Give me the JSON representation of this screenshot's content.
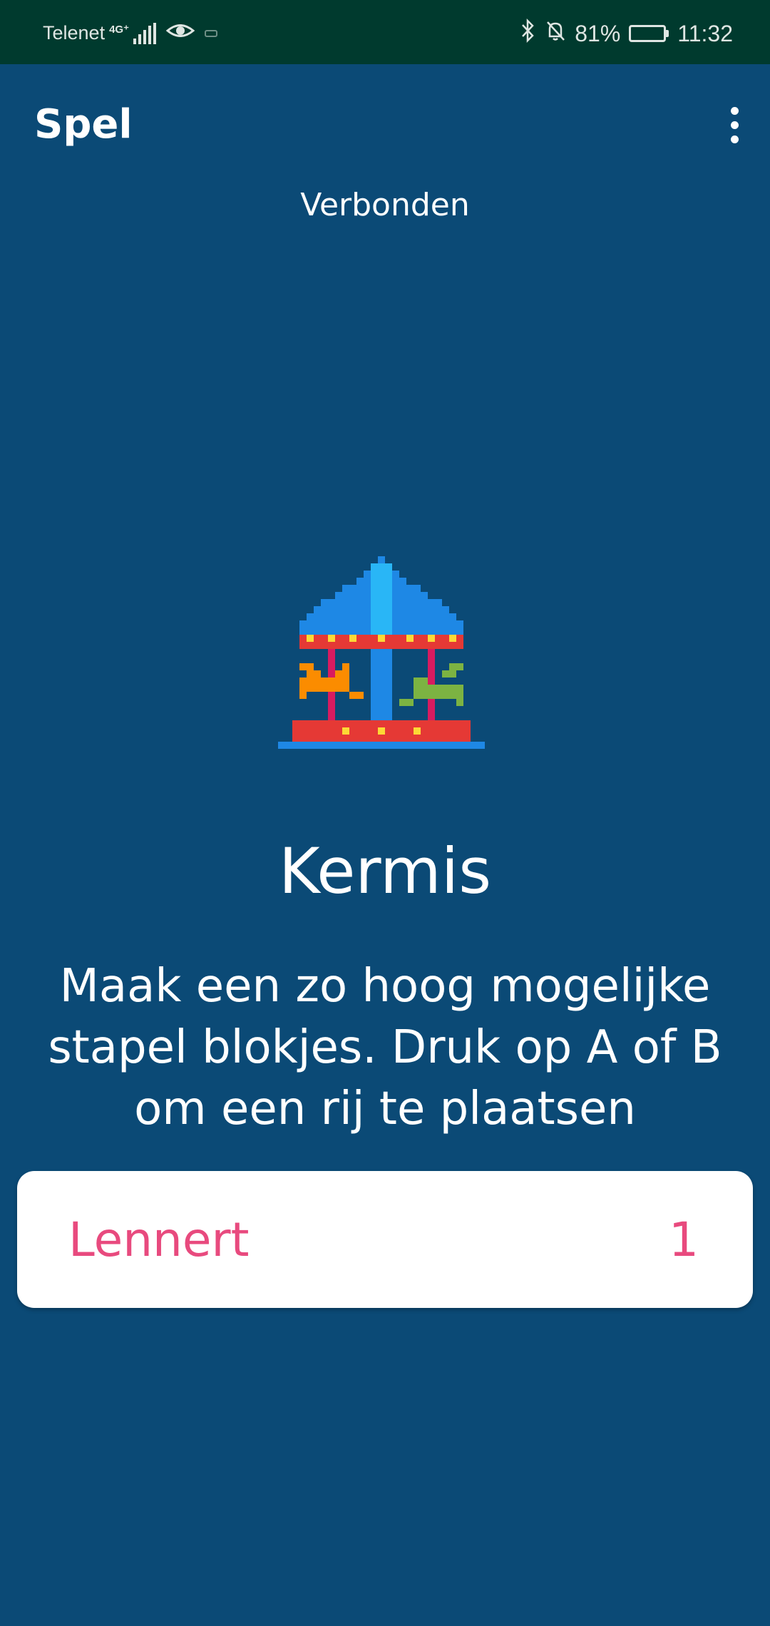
{
  "statusbar": {
    "carrier": "Telenet",
    "network_type": "4G⁺",
    "battery_percent": "81%",
    "battery_level": 0.81,
    "time": "11:32"
  },
  "appbar": {
    "title": "Spel"
  },
  "connection_status": "Verbonden",
  "game": {
    "icon": "carousel-icon",
    "title": "Kermis",
    "description": "Maak een zo hoog mogelijke stapel blokjes. Druk op A of B om een rij te plaatsen"
  },
  "players": [
    {
      "name": "Lennert",
      "score": "1"
    }
  ],
  "colors": {
    "background": "#0b4a76",
    "statusbar": "#003a2e",
    "player_accent": "#e84a7e"
  }
}
